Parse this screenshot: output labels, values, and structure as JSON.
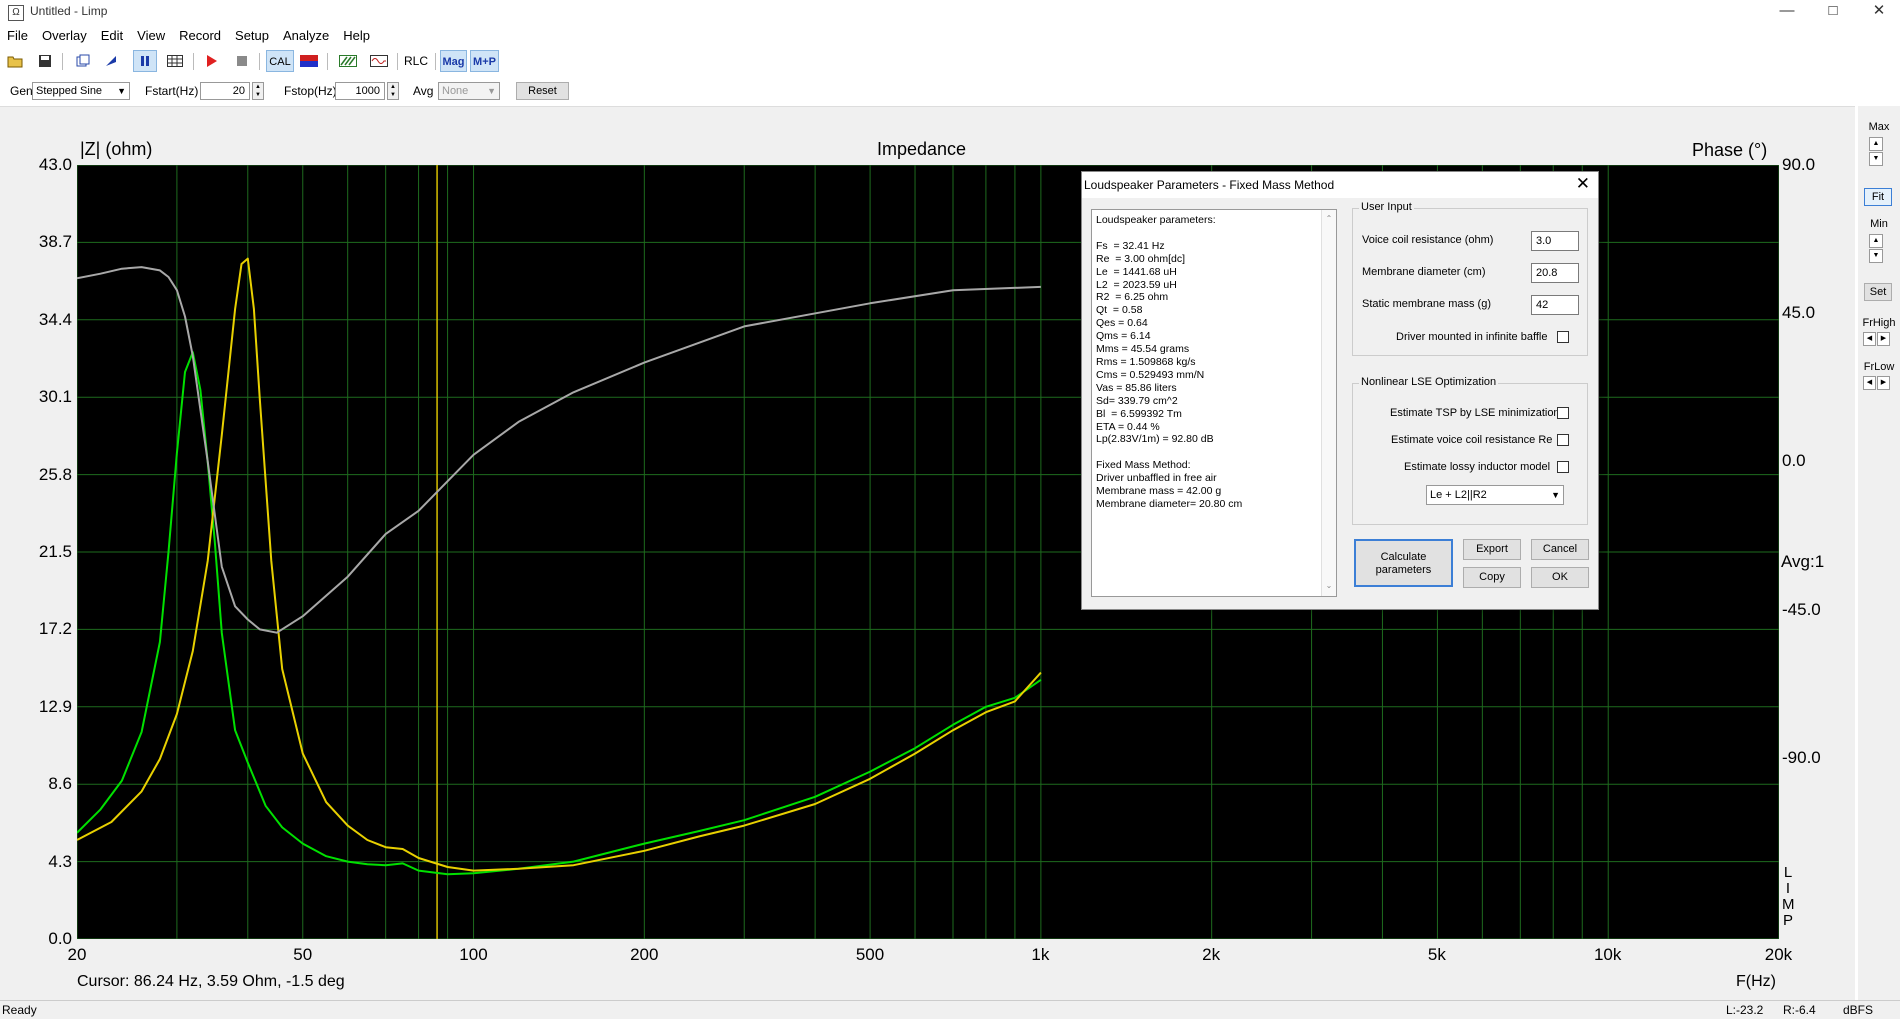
{
  "window": {
    "title": "Untitled - Limp",
    "app_icon": "Ω"
  },
  "menu": [
    "File",
    "Overlay",
    "Edit",
    "View",
    "Record",
    "Setup",
    "Analyze",
    "Help"
  ],
  "toolbar": {
    "cal_label": "CAL",
    "rlc_label": "RLC",
    "mag_label": "Mag",
    "mp_label": "M+P"
  },
  "params": {
    "gen_label": "Gen",
    "gen_value": "Stepped Sine",
    "fstart_label": "Fstart(Hz)",
    "fstart_value": "20",
    "fstop_label": "Fstop(Hz)",
    "fstop_value": "1000",
    "avg_label": "Avg",
    "avg_value": "None",
    "reset_label": "Reset"
  },
  "graph": {
    "title": "Impedance",
    "left_axis_title": "|Z| (ohm)",
    "right_axis_title": "Phase (°)",
    "x_axis_title": "F(Hz)",
    "y_ticks": [
      "43.0",
      "38.7",
      "34.4",
      "30.1",
      "25.8",
      "21.5",
      "17.2",
      "12.9",
      "8.6",
      "4.3",
      "0.0"
    ],
    "phase_ticks": [
      "90.0",
      "45.0",
      "0.0",
      "-45.0",
      "-90.0"
    ],
    "x_ticks": [
      "20",
      "50",
      "100",
      "200",
      "500",
      "1k",
      "2k",
      "5k",
      "10k",
      "20k"
    ],
    "avg_text": "Avg:1",
    "side_label": [
      "L",
      "I",
      "M",
      "P"
    ],
    "cursor_text": "Cursor: 86.24 Hz, 3.59 Ohm, -1.5 deg",
    "colors": {
      "background": "#000000",
      "grid": "#1e6b1e",
      "green_trace": "#00e000",
      "yellow_trace": "#e8d000",
      "phase_trace": "#a8a8a8",
      "cursor": "#d8c000"
    }
  },
  "chart_data": {
    "type": "line",
    "title": "Impedance",
    "xlabel": "F(Hz)",
    "ylabel": "|Z| (ohm)",
    "y2label": "Phase (°)",
    "xscale": "log",
    "xlim": [
      20,
      20000
    ],
    "ylim": [
      0,
      43
    ],
    "y2lim": [
      -145,
      90
    ],
    "grid": true,
    "cursor_x": 86.24,
    "series": [
      {
        "color": "#00e000",
        "axis": "left",
        "x": [
          20,
          22,
          24,
          26,
          28,
          29,
          30,
          31,
          32,
          33,
          34,
          35,
          36,
          38,
          40,
          43,
          46,
          50,
          55,
          60,
          65,
          70,
          75,
          80,
          90,
          100,
          120,
          150,
          200,
          250,
          300,
          400,
          500,
          600,
          700,
          800,
          900,
          1000
        ],
        "y": [
          5.9,
          7.2,
          8.8,
          11.5,
          16.5,
          21.5,
          27,
          31.5,
          32.6,
          30.5,
          26.5,
          22,
          17,
          11.6,
          9.8,
          7.4,
          6.2,
          5.3,
          4.6,
          4.3,
          4.15,
          4.1,
          4.2,
          3.8,
          3.6,
          3.65,
          3.9,
          4.3,
          5.3,
          6.0,
          6.6,
          7.9,
          9.3,
          10.6,
          11.9,
          12.9,
          13.4,
          14.4
        ]
      },
      {
        "color": "#e8d000",
        "axis": "left",
        "x": [
          20,
          23,
          26,
          28,
          30,
          32,
          34,
          36,
          38,
          39,
          40,
          41,
          42,
          44,
          46,
          50,
          55,
          60,
          65,
          70,
          75,
          80,
          90,
          100,
          120,
          150,
          200,
          250,
          300,
          400,
          500,
          600,
          700,
          800,
          900,
          1000
        ],
        "y": [
          5.5,
          6.5,
          8.2,
          10,
          12.5,
          16,
          21,
          28,
          35,
          37.5,
          37.8,
          35,
          30,
          21,
          15,
          10.3,
          7.6,
          6.3,
          5.5,
          5.1,
          5.0,
          4.5,
          4.0,
          3.8,
          3.9,
          4.1,
          4.9,
          5.7,
          6.3,
          7.5,
          8.9,
          10.3,
          11.6,
          12.6,
          13.2,
          14.8
        ]
      },
      {
        "color": "#a8a8a8",
        "axis": "right",
        "x": [
          20,
          22,
          24,
          26,
          28,
          29,
          30,
          31,
          32,
          34,
          36,
          38,
          40,
          42,
          45,
          50,
          60,
          70,
          80,
          90,
          100,
          120,
          150,
          200,
          300,
          500,
          700,
          1000
        ],
        "y": [
          55.6,
          57,
          58.5,
          59,
          58,
          56,
          52,
          44,
          32,
          0,
          -32,
          -44,
          -48,
          -51,
          -52,
          -47,
          -35,
          -22,
          -15,
          -6,
          2,
          12,
          21,
          30,
          41,
          48,
          52,
          53
        ]
      }
    ]
  },
  "right_panel": {
    "max_label": "Max",
    "fit_label": "Fit",
    "min_label": "Min",
    "set_label": "Set",
    "frhigh_label": "FrHigh",
    "frlow_label": "FrLow"
  },
  "status": {
    "ready": "Ready",
    "l_value": "L:-23.2",
    "r_value": "R:-6.4",
    "units": "dBFS"
  },
  "dialog": {
    "title": "Loudspeaker Parameters - Fixed Mass Method",
    "results_text": "Loudspeaker parameters:\n\nFs  = 32.41 Hz\nRe  = 3.00 ohm[dc]\nLe  = 1441.68 uH\nL2  = 2023.59 uH\nR2  = 6.25 ohm\nQt  = 0.58\nQes = 0.64\nQms = 6.14\nMms = 45.54 grams\nRms = 1.509868 kg/s\nCms = 0.529493 mm/N\nVas = 85.86 liters\nSd= 339.79 cm^2\nBl  = 6.599392 Tm\nETA = 0.44 %\nLp(2.83V/1m) = 92.80 dB\n\nFixed Mass Method:\nDriver unbaffled in free air\nMembrane mass = 42.00 g\nMembrane diameter= 20.80 cm",
    "user_input": {
      "group_title": "User Input",
      "voice_coil_label": "Voice coil resistance (ohm)",
      "voice_coil_value": "3.0",
      "diameter_label": "Membrane diameter (cm)",
      "diameter_value": "20.8",
      "mass_label": "Static membrane mass (g)",
      "mass_value": "42",
      "baffle_label": "Driver mounted in infinite baffle"
    },
    "lse": {
      "group_title": "Nonlinear LSE Optimization",
      "tsp_label": "Estimate TSP by LSE minimization",
      "re_label": "Estimate voice coil resistance Re",
      "inductor_label": "Estimate lossy inductor model",
      "model_value": "Le + L2||R2"
    },
    "buttons": {
      "calc_line1": "Calculate",
      "calc_line2": "parameters",
      "export": "Export",
      "cancel": "Cancel",
      "copy": "Copy",
      "ok": "OK"
    }
  }
}
